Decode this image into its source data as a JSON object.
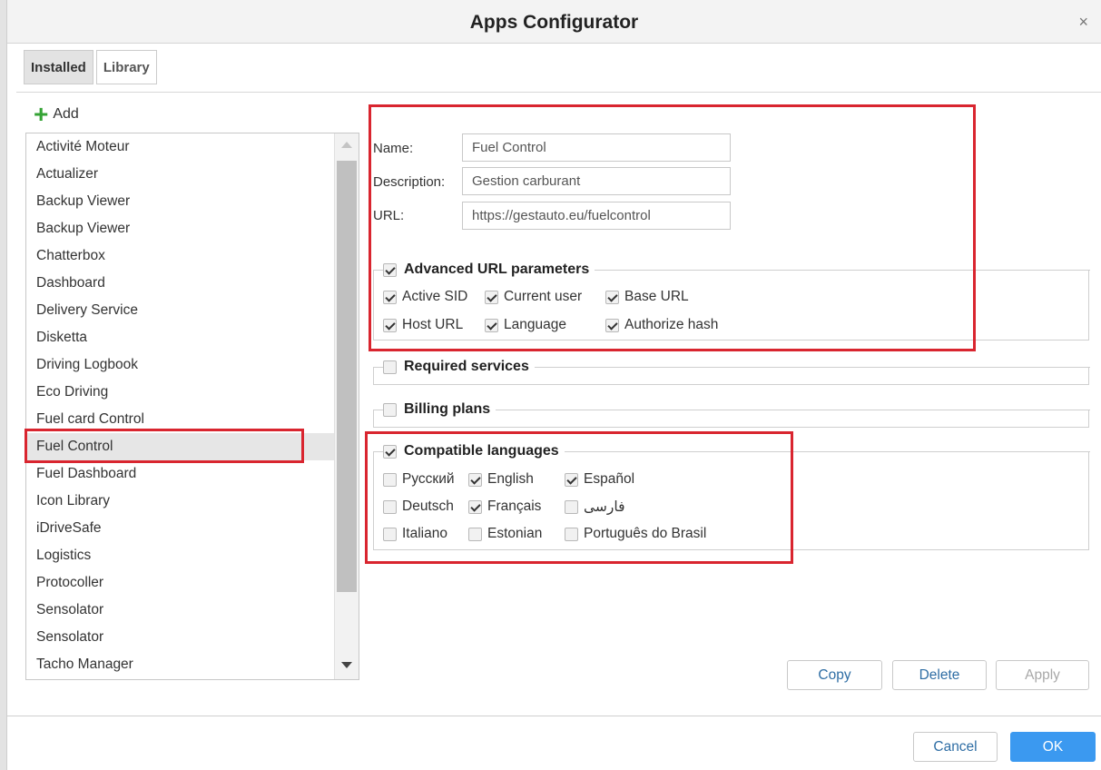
{
  "window": {
    "title": "Apps Configurator",
    "close_symbol": "×"
  },
  "tabs": [
    {
      "label": "Installed",
      "active": true
    },
    {
      "label": "Library",
      "active": false
    }
  ],
  "add_label": "Add",
  "apps": [
    "Activité Moteur",
    "Actualizer",
    "Backup Viewer",
    "Backup Viewer",
    "Chatterbox",
    "Dashboard",
    "Delivery Service",
    "Disketta",
    "Driving Logbook",
    "Eco Driving",
    "Fuel card Control",
    "Fuel Control",
    "Fuel Dashboard",
    "Icon Library",
    "iDriveSafe",
    "Logistics",
    "Protocoller",
    "Sensolator",
    "Sensolator",
    "Tacho Manager"
  ],
  "selected_app_index": 11,
  "form": {
    "name_label": "Name:",
    "name_value": "Fuel Control",
    "description_label": "Description:",
    "description_value": "Gestion carburant",
    "url_label": "URL:",
    "url_value": "https://gestauto.eu/fuelcontrol"
  },
  "advanced": {
    "label": "Advanced URL parameters",
    "checked": true,
    "options": [
      {
        "label": "Active SID",
        "checked": true
      },
      {
        "label": "Current user",
        "checked": true
      },
      {
        "label": "Base URL",
        "checked": true
      },
      {
        "label": "Host URL",
        "checked": true
      },
      {
        "label": "Language",
        "checked": true
      },
      {
        "label": "Authorize hash",
        "checked": true
      }
    ]
  },
  "required_services": {
    "label": "Required services",
    "checked": false
  },
  "billing_plans": {
    "label": "Billing plans",
    "checked": false
  },
  "languages": {
    "label": "Compatible languages",
    "checked": true,
    "options": [
      {
        "label": "Русский",
        "checked": false
      },
      {
        "label": "English",
        "checked": true
      },
      {
        "label": "Español",
        "checked": true
      },
      {
        "label": "Deutsch",
        "checked": false
      },
      {
        "label": "Français",
        "checked": true
      },
      {
        "label": "فارسی",
        "checked": false
      },
      {
        "label": "Italiano",
        "checked": false
      },
      {
        "label": "Estonian",
        "checked": false
      },
      {
        "label": "Português do Brasil",
        "checked": false
      }
    ]
  },
  "buttons": {
    "copy": "Copy",
    "delete": "Delete",
    "apply": "Apply",
    "cancel": "Cancel",
    "ok": "OK"
  },
  "colors": {
    "highlight_box": "#d9252f",
    "ok_button": "#3b99f0",
    "add_icon": "#35a335"
  }
}
